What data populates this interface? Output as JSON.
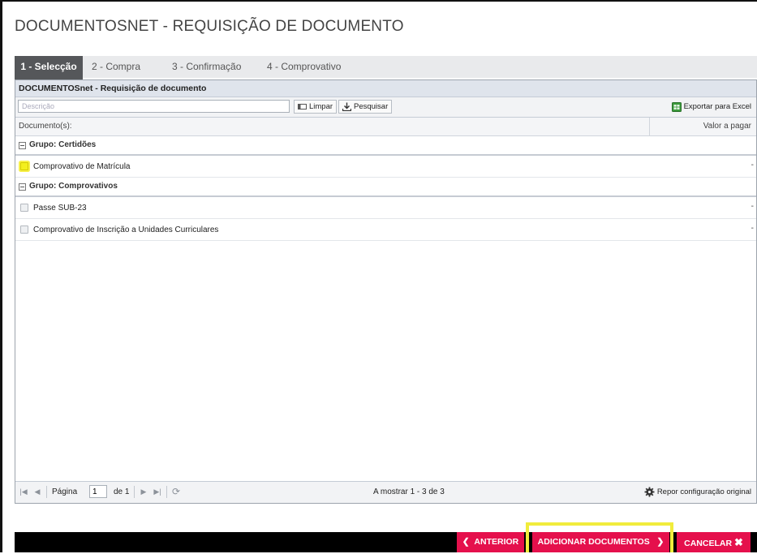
{
  "page": {
    "title": "DOCUMENTOSNET - REQUISIÇÃO DE DOCUMENTO"
  },
  "tabs": [
    {
      "label": "1 - Selecção",
      "active": true
    },
    {
      "label": "2 - Compra"
    },
    {
      "label": "3 - Confirmação"
    },
    {
      "label": "4 - Comprovativo"
    }
  ],
  "grid": {
    "title": "DOCUMENTOSnet - Requisição de documento",
    "search_placeholder": "Descrição",
    "clear_label": "Limpar",
    "search_label": "Pesquisar",
    "export_label": "Exportar para Excel",
    "col_document": "Documento(s):",
    "col_value": "Valor a pagar",
    "groups": [
      {
        "label": "Grupo: Certidões",
        "items": [
          {
            "label": "Comprovativo de Matrícula",
            "value": "-",
            "highlighted": true
          }
        ]
      },
      {
        "label": "Grupo: Comprovativos",
        "items": [
          {
            "label": "Passe SUB-23",
            "value": "-"
          },
          {
            "label": "Comprovativo de Inscrição a Unidades Curriculares",
            "value": "-"
          }
        ]
      }
    ]
  },
  "pager": {
    "page_label": "Página",
    "page_value": "1",
    "of_label": "de 1",
    "showing": "A mostrar 1 - 3 de 3",
    "reset_label": "Repor configuração original"
  },
  "actions": {
    "prev_label": "ANTERIOR",
    "add_label": "ADICIONAR DOCUMENTOS",
    "cancel_label": "CANCELAR"
  },
  "colors": {
    "accent": "#e5104c",
    "highlight": "#f1ec3c",
    "tab_active": "#55575a"
  }
}
